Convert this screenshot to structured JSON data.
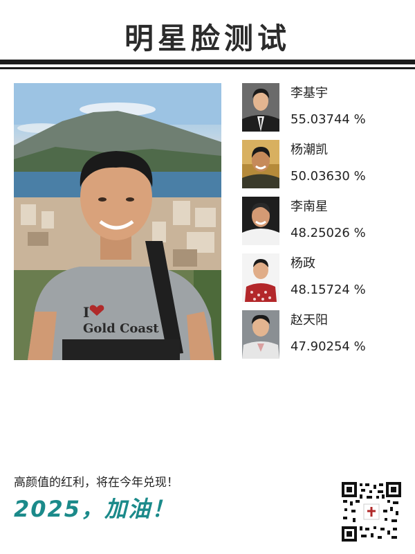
{
  "page": {
    "title": "明星脸测试"
  },
  "matches": [
    {
      "name": "李基宇",
      "score": "55.03744 %",
      "icon": "celebrity-portrait"
    },
    {
      "name": "杨潮凯",
      "score": "50.03630 %",
      "icon": "celebrity-portrait"
    },
    {
      "name": "李南星",
      "score": "48.25026 %",
      "icon": "celebrity-portrait"
    },
    {
      "name": "杨政",
      "score": "48.15724 %",
      "icon": "celebrity-portrait"
    },
    {
      "name": "赵天阳",
      "score": "47.90254 %",
      "icon": "celebrity-portrait"
    }
  ],
  "footer": {
    "tagline": "高颜值的红利，将在今年兑现！",
    "slogan": "2025，加油！",
    "slogan_color": "#1b8a8a"
  },
  "photo": {
    "shirt_text": "I ❤ Gold Coast"
  }
}
